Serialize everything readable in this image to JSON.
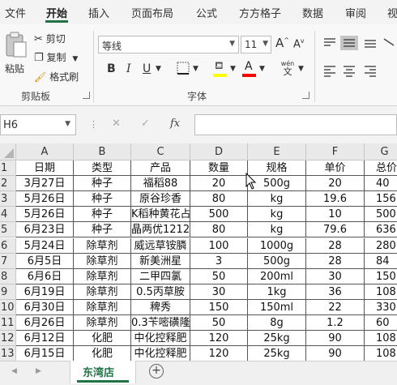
{
  "ribbon_tabs": [
    "文件",
    "开始",
    "插入",
    "页面布局",
    "公式",
    "方方格子",
    "数据",
    "审阅",
    "视"
  ],
  "clipboard": {
    "paste": "粘贴",
    "cut": "剪切",
    "copy": "复制",
    "format_painter": "格式刷",
    "group_label": "剪贴板"
  },
  "font": {
    "name": "等线",
    "size": "11",
    "bold": "B",
    "italic": "I",
    "underline": "U",
    "grow": "A",
    "shrink": "A",
    "wen": "wén",
    "wen_char": "文",
    "group_label": "字体",
    "fill_color": "#ffff00",
    "font_color": "#ff0000"
  },
  "formula_bar": {
    "name_box": "H6",
    "cancel": "✕",
    "enter": "✓",
    "fx": "fx",
    "value": ""
  },
  "grid": {
    "columns": [
      "A",
      "B",
      "C",
      "D",
      "E",
      "F",
      "G"
    ],
    "row_numbers": [
      "1",
      "2",
      "3",
      "4",
      "5",
      "6",
      "7",
      "8",
      "9",
      "10",
      "11",
      "12",
      "13"
    ],
    "rows": [
      [
        "日期",
        "类型",
        "产品",
        "数量",
        "规格",
        "单价",
        "总价"
      ],
      [
        "3月27日",
        "种子",
        "福稻88",
        "20",
        "500g",
        "20",
        "40"
      ],
      [
        "5月26日",
        "种子",
        "原谷珍香",
        "80",
        "kg",
        "19.6",
        "156"
      ],
      [
        "5月26日",
        "种子",
        "K稻种黄花占",
        "500",
        "kg",
        "10",
        "500"
      ],
      [
        "6月23日",
        "种子",
        "晶两优1212",
        "80",
        "kg",
        "79.6",
        "636"
      ],
      [
        "5月24日",
        "除草剂",
        "威远草铵膦",
        "100",
        "1000g",
        "28",
        "280"
      ],
      [
        "6月5日",
        "除草剂",
        "新美洲星",
        "3",
        "500g",
        "28",
        "84"
      ],
      [
        "6月6日",
        "除草剂",
        "二甲四氯",
        "50",
        "200ml",
        "30",
        "150"
      ],
      [
        "6月19日",
        "除草剂",
        "0.5丙草胺",
        "30",
        "1kg",
        "36",
        "108"
      ],
      [
        "6月30日",
        "除草剂",
        "稗秀",
        "150",
        "150ml",
        "22",
        "330"
      ],
      [
        "6月26日",
        "除草剂",
        "0.3苄嘧磺隆",
        "50",
        "8g",
        "1.2",
        "60"
      ],
      [
        "6月12日",
        "化肥",
        "中化控释肥",
        "120",
        "25kg",
        "90",
        "108"
      ],
      [
        "6月15日",
        "化肥",
        "中化控释肥",
        "120",
        "25kg",
        "90",
        "108"
      ]
    ]
  },
  "sheet_tabs": {
    "active": "东湾店",
    "add": "+",
    "prev": "◀",
    "next": "▶"
  }
}
